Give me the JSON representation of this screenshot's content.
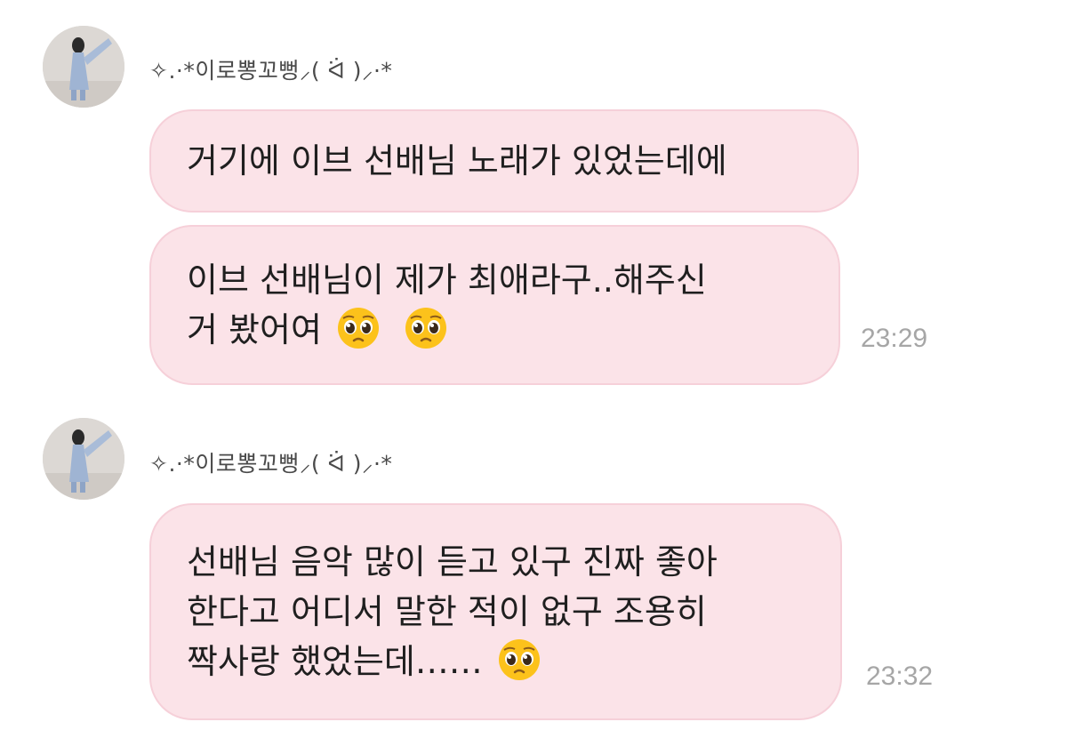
{
  "messages": [
    {
      "sender": "✧.·*이로뽕꼬뻥⸝( ᐛ )⸝·*",
      "bubbles": [
        {
          "lines": [
            "거기에 이브 선배님 노래가 있었는데에"
          ]
        },
        {
          "lines": [
            "이브 선배님이 제가 최애라구..해주신",
            "거 봤어여"
          ],
          "emoji_icons": [
            "pleading-face-emoji",
            "pleading-face-emoji"
          ]
        }
      ],
      "time": "23:29"
    },
    {
      "sender": "✧.·*이로뽕꼬뻥⸝( ᐛ )⸝·*",
      "bubbles": [
        {
          "lines": [
            "선배님 음악 많이 듣고 있구 진짜 좋아",
            "한다고 어디서 말한 적이 없구 조용히",
            "짝사랑 했었는데……"
          ],
          "emoji_icons": [
            "pleading-face-emoji"
          ]
        }
      ],
      "time": "23:32"
    }
  ],
  "colors": {
    "bubble_bg": "#fbe3e8",
    "bubble_border": "#f6d0d9",
    "timestamp": "#a6a6a6",
    "sender_name": "#4a4a4a"
  }
}
